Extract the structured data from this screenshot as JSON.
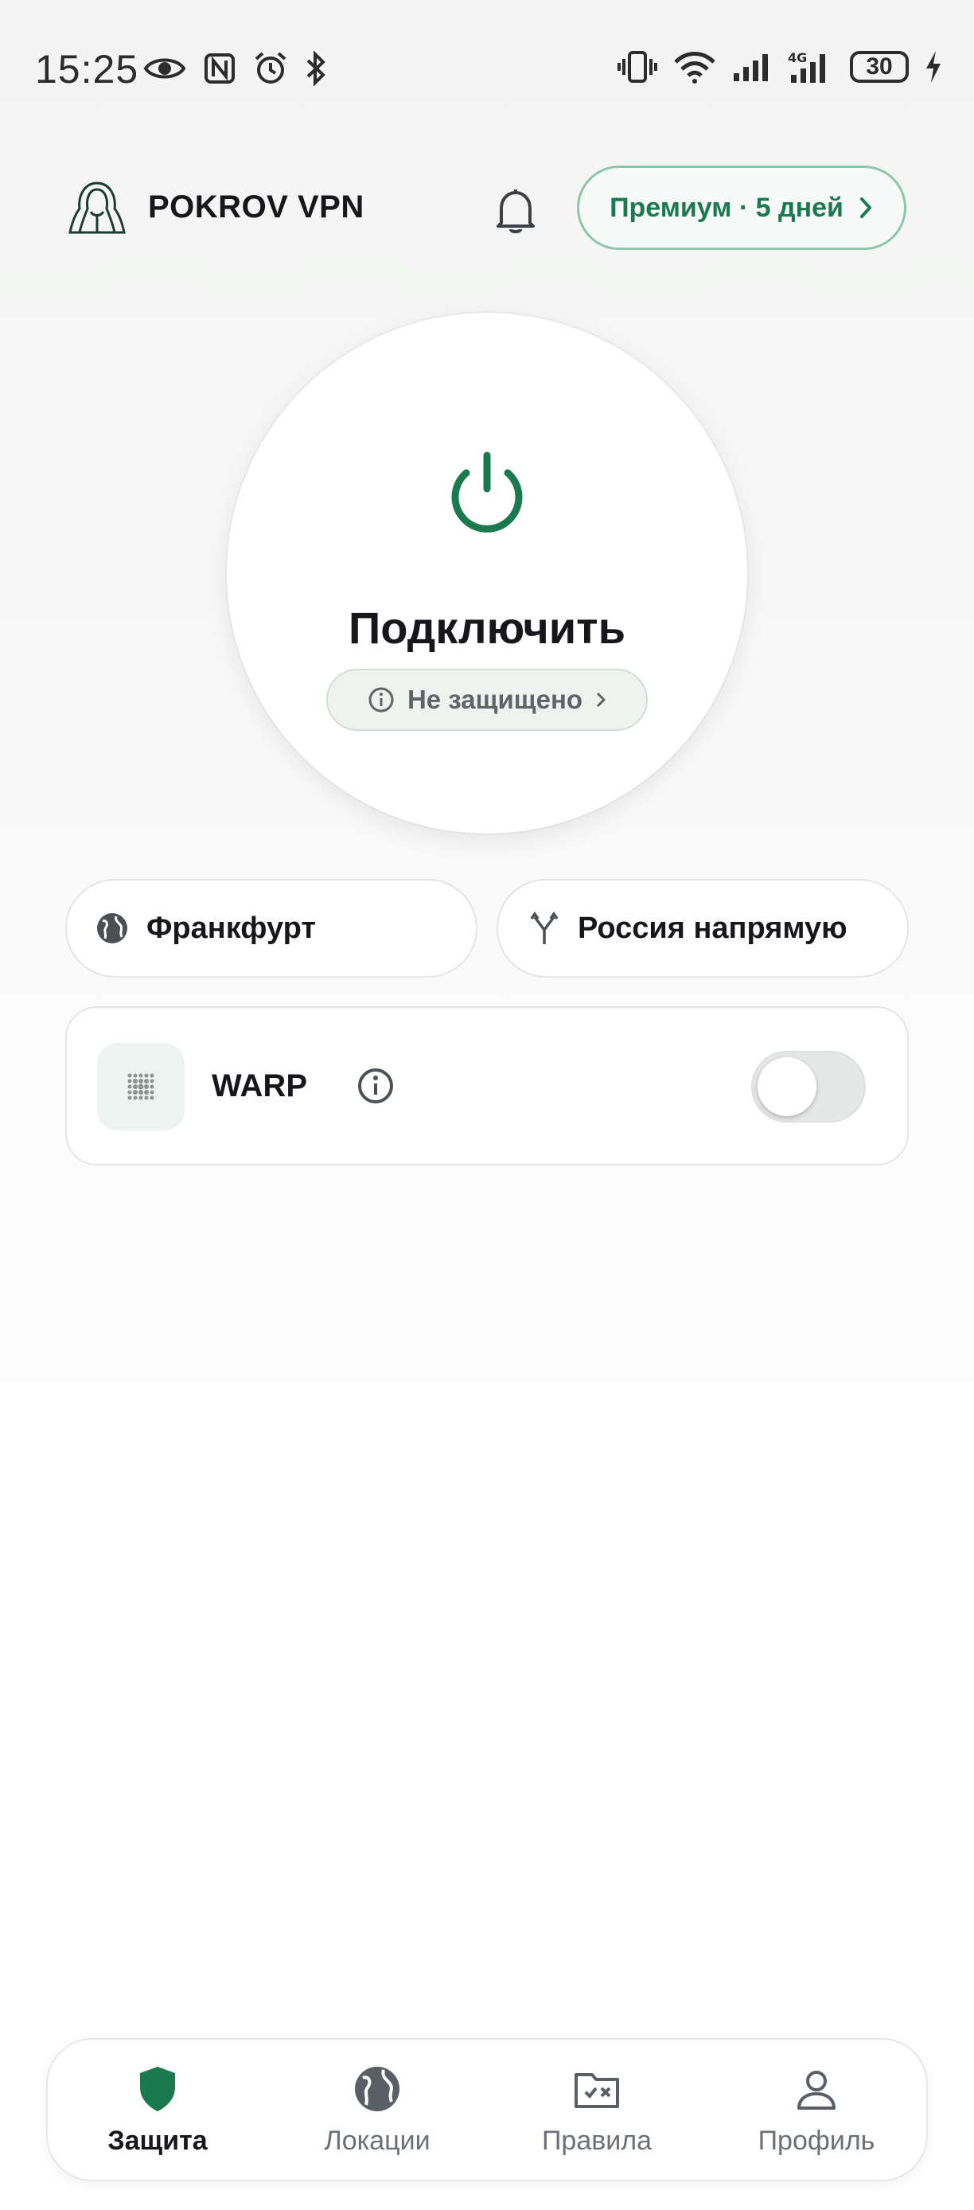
{
  "status_bar": {
    "time": "15:25",
    "battery": "30",
    "network": "4G"
  },
  "header": {
    "app_title": "POKROV VPN",
    "premium_label": "Премиум · 5 дней",
    "accent_color": "#1a7a4e"
  },
  "connect": {
    "button_label": "Подключить",
    "status_label": "Не защищено"
  },
  "locations": {
    "server": "Франкфурт",
    "routing": "Россия напрямую"
  },
  "warp": {
    "label": "WARP",
    "enabled": false
  },
  "bottom_nav": {
    "items": [
      {
        "label": "Защита",
        "icon": "shield-icon",
        "active": true
      },
      {
        "label": "Локации",
        "icon": "globe-icon",
        "active": false
      },
      {
        "label": "Правила",
        "icon": "rules-folder-icon",
        "active": false
      },
      {
        "label": "Профиль",
        "icon": "user-icon",
        "active": false
      }
    ]
  }
}
